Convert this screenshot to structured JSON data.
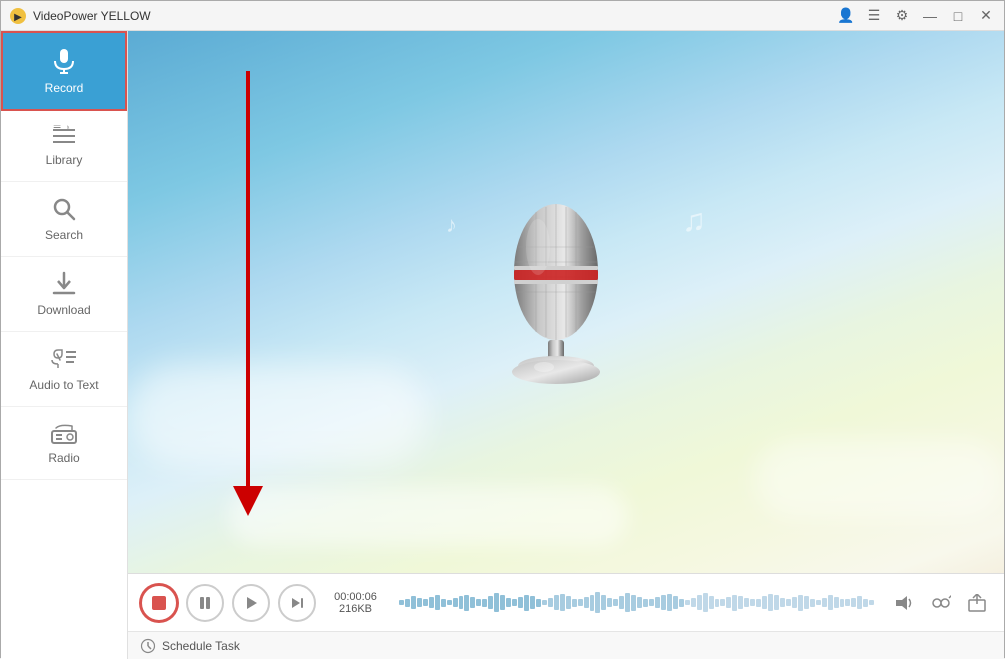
{
  "app": {
    "title": "VideoPower YELLOW",
    "logo_char": "🎬"
  },
  "titlebar": {
    "controls": [
      "👤",
      "☰",
      "⚙",
      "—",
      "□",
      "✕"
    ]
  },
  "sidebar": {
    "items": [
      {
        "id": "record",
        "label": "Record",
        "icon": "🎤",
        "active": true
      },
      {
        "id": "library",
        "label": "Library",
        "icon": "≡",
        "active": false
      },
      {
        "id": "search",
        "label": "Search",
        "icon": "🔍",
        "active": false
      },
      {
        "id": "download",
        "label": "Download",
        "icon": "⬇",
        "active": false
      },
      {
        "id": "audio-to-text",
        "label": "Audio to Text",
        "icon": "🔊",
        "active": false
      },
      {
        "id": "radio",
        "label": "Radio",
        "icon": "📻",
        "active": false
      }
    ]
  },
  "controls": {
    "time": "00:00:06",
    "size": "216KB",
    "schedule_label": "Schedule Task"
  },
  "waveform": {
    "bar_count": 80,
    "heights": [
      3,
      5,
      8,
      6,
      4,
      7,
      9,
      5,
      3,
      6,
      8,
      10,
      7,
      4,
      5,
      8,
      12,
      9,
      6,
      4,
      7,
      10,
      8,
      5,
      3,
      6,
      9,
      11,
      8,
      5,
      4,
      7,
      10,
      13,
      9,
      6,
      4,
      8,
      12,
      10,
      7,
      5,
      4,
      7,
      9,
      11,
      8,
      5,
      3,
      6,
      9,
      12,
      8,
      5,
      4,
      7,
      10,
      8,
      6,
      4,
      5,
      8,
      11,
      9,
      6,
      4,
      7,
      10,
      8,
      5,
      3,
      6,
      9,
      7,
      5,
      4,
      6,
      8,
      5,
      3
    ]
  }
}
